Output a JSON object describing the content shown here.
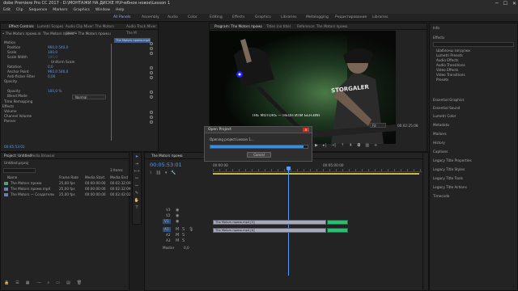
{
  "titlebar": {
    "title": "dobe Premiere Pro CC 2017 - D:\\МОНТАЖИ НА ДИСКЕ Н\\Учебное новое\\Lesson 1",
    "minimize": "─",
    "maximize": "☐",
    "close": "✕"
  },
  "menu": [
    "Edit",
    "Clip",
    "Sequence",
    "Markers",
    "Graphics",
    "Window",
    "Help"
  ],
  "workspaces": [
    "All Panels",
    "Assembly",
    "Audio",
    "Color",
    "Editing",
    "Effects",
    "Graphics",
    "Libraries",
    "Metalogging",
    "Редактирование",
    "Libraries"
  ],
  "effect_controls": {
    "tabs": [
      "Effect Controls",
      "Lumetri Scopes",
      "Audio Clip Mixer: The Motors промо",
      "Audio Track Mixer: The M"
    ],
    "source": "• The Motors промо.mp4",
    "sequence": "The Motors промо • The Motors промо.mp4",
    "clip_label": "The Motors промо.mp4",
    "rows": [
      {
        "label": "Motion",
        "value": ""
      },
      {
        "label": "Position",
        "value": "960,0    540,0"
      },
      {
        "label": "Scale",
        "value": "100,0"
      },
      {
        "label": "Scale Width",
        "value": "100,0"
      },
      {
        "label": "",
        "value": "Uniform Scale"
      },
      {
        "label": "Rotation",
        "value": "0,0"
      },
      {
        "label": "Anchor Point",
        "value": "960,0    540,0"
      },
      {
        "label": "Anti-flicker Filter",
        "value": "0,00"
      },
      {
        "label": "Opacity",
        "value": ""
      },
      {
        "label": "",
        "value": ""
      },
      {
        "label": "Opacity",
        "value": "100,0 %"
      },
      {
        "label": "Blend Mode",
        "value": "Normal"
      },
      {
        "label": "Time Remapping",
        "value": ""
      },
      {
        "label": "Effects",
        "value": ""
      },
      {
        "label": "Volume",
        "value": ""
      },
      {
        "label": "Channel Volume",
        "value": ""
      },
      {
        "label": "Panner",
        "value": ""
      }
    ],
    "timecode": "00:05:53:01"
  },
  "program": {
    "tabs": [
      "Program: The Motors промо",
      "Titles (no title)",
      "Reference: The Motors промо"
    ],
    "overlay_text": "THE MOTORS — НЕОН ИЛИ БЕНЗИН",
    "sign_text": "STORGALER",
    "fit": "Fit",
    "duration": "00:02:25:08"
  },
  "project": {
    "tabs": [
      "Project: Untitled",
      "Media Browser"
    ],
    "filename": "Untitled.prproj",
    "items_count": "3 Items",
    "headers": [
      "Name",
      "Frame Rate",
      "Media Start",
      "Media End"
    ],
    "rows": [
      {
        "name": "The Motors промо",
        "rate": "25,00 fps",
        "start": "00:00:00:00",
        "end": "00:02:32:09"
      },
      {
        "name": "The Motors промо.mp4",
        "rate": "25,00 fps",
        "start": "00:00:00:00",
        "end": "00:02:32:09"
      },
      {
        "name": "The Motors — Создатели",
        "rate": "25,00 fps",
        "start": "00:00:00:00",
        "end": "00:02:42:02"
      }
    ]
  },
  "timeline": {
    "tab": "The Motors промо",
    "timecode": "00:05:53:01",
    "ruler": [
      "00:00:00",
      "00:05:00:00"
    ],
    "tracks": [
      "V3",
      "V2",
      "V1",
      "A1",
      "A2",
      "A3",
      "Master"
    ],
    "master_value": "0,0",
    "video_clip": "The Motors промо.mp4 [V]",
    "audio_clip": "The Motors промо.mp4 [A]"
  },
  "dialog": {
    "title": "Open Project",
    "message": "Opening project Lesson 1...",
    "cancel": "Cancel",
    "progress": 0.96
  },
  "effects_panel": {
    "tabs": [
      "Info",
      "Effects"
    ],
    "search_placeholder": "",
    "folders": [
      "Шаблоны загрузки",
      "Lumetri Presets",
      "Audio Effects",
      "Audio Transitions",
      "Video Effects",
      "Video Transitions",
      "Presets"
    ],
    "sections": [
      "Essential Graphics",
      "Essential Sound",
      "Lumetri Color",
      "Metadata",
      "Markers",
      "History",
      "Captions",
      "Legacy Title Properties",
      "Legacy Title Styles",
      "Legacy Title Tools",
      "Legacy Title Actions",
      "Timecode"
    ]
  },
  "colors": {
    "accent": "#5a9cf2",
    "panel": "#232323",
    "clip_green": "#2dbc71",
    "clip_gray": "#a6a9b8"
  }
}
